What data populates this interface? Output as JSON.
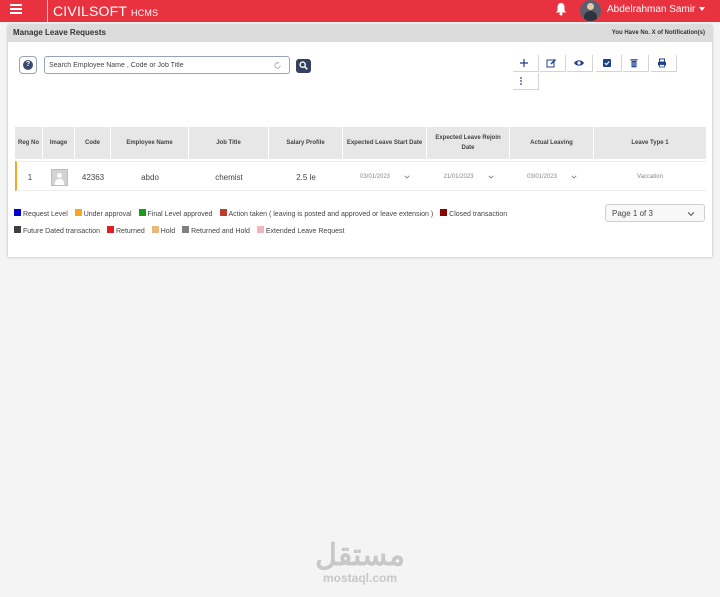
{
  "header": {
    "brand": "CIVILSOFT",
    "brand_sub": "HCMS",
    "user_name": "Abdelrahman Samir"
  },
  "page": {
    "title": "Manage Leave Requests",
    "notifications": "You Have No. X of Notification(s)"
  },
  "search": {
    "placeholder": "Search Employee Name , Code or Job Title"
  },
  "toolbar": {
    "icons": [
      "add-icon",
      "edit-icon",
      "view-icon",
      "approve-icon",
      "delete-icon",
      "print-icon",
      "more-icon"
    ]
  },
  "table": {
    "headers": {
      "reg_no": "Reg No",
      "image": "Image",
      "code": "Code",
      "employee_name": "Employee Name",
      "job_title": "Job Title",
      "salary_profile": "Salary Profile",
      "expected_start": "Expected Leave Start Date",
      "expected_rejoin": "Expected Leave Rejoin Date",
      "actual_leaving": "Actual Leaving",
      "leave_type": "Leave Type 1"
    },
    "rows": [
      {
        "reg_no": "1",
        "code": "42363",
        "employee_name": "abdo",
        "job_title": "chemist",
        "salary_profile": "2.5 le",
        "expected_start": "03/01/2023",
        "expected_rejoin": "21/01/2023",
        "actual_leaving": "03/01/2023",
        "leave_type": "Vaccation"
      }
    ]
  },
  "legend": {
    "row1": [
      {
        "label": "Request Level",
        "color": "#0000cc"
      },
      {
        "label": "Under approval",
        "color": "#f5a623"
      },
      {
        "label": "Final Level approved",
        "color": "#1a9c1a"
      },
      {
        "label": "Action taken ( leaving is posted and approved or leave extension )",
        "color": "#c0392b"
      },
      {
        "label": "Closed transaction",
        "color": "#8b0000"
      }
    ],
    "row2": [
      {
        "label": "Future Dated transaction",
        "color": "#404040"
      },
      {
        "label": "Returned",
        "color": "#e02020"
      },
      {
        "label": "Hold",
        "color": "#e8b77a"
      },
      {
        "label": "Returned and Hold",
        "color": "#808080"
      },
      {
        "label": "Extended Leave Request",
        "color": "#f5b5c0"
      }
    ]
  },
  "pager": {
    "label": "Page 1 of 3"
  },
  "watermark": {
    "arabic": "مستقل",
    "latin": "mostaql.com"
  }
}
